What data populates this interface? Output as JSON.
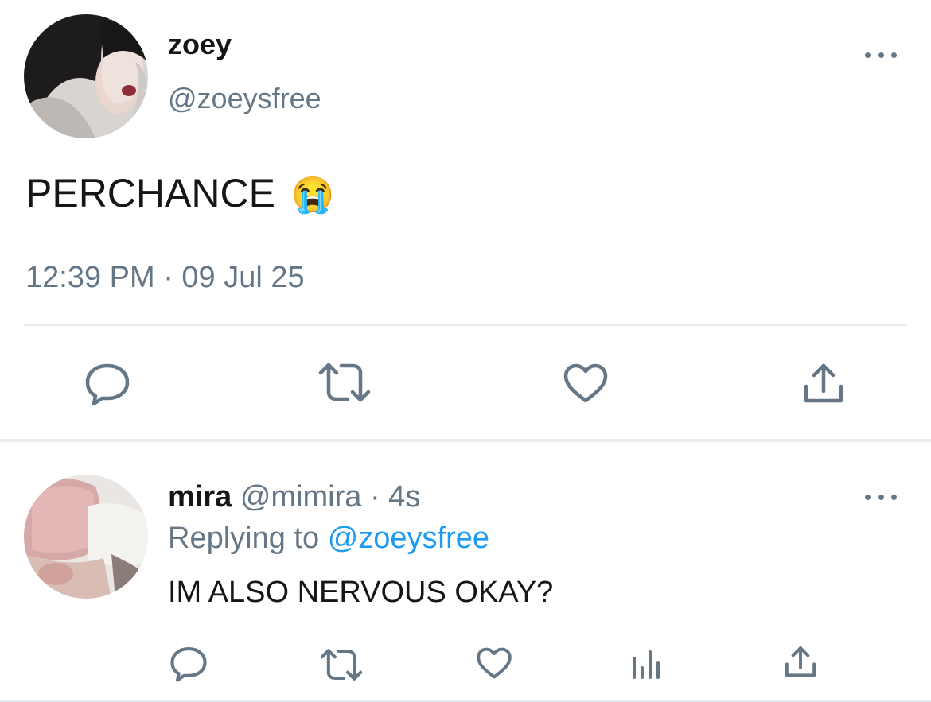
{
  "tweet": {
    "author": {
      "name": "zoey",
      "handle": "@zoeysfree",
      "avatar_icon": "avatar-photo-icon"
    },
    "text": "PERCHANCE",
    "emoji": "😭",
    "timestamp": "12:39 PM · 09 Jul 25",
    "actions": [
      "reply-icon",
      "retweet-icon",
      "like-icon",
      "share-icon"
    ]
  },
  "reply": {
    "author": {
      "name": "mira",
      "handle": "@mimira",
      "time": "· 4s",
      "avatar_icon": "avatar-photo-icon"
    },
    "replying_prefix": "Replying to",
    "replying_to": "@zoeysfree",
    "text": "IM ALSO NERVOUS OKAY?",
    "actions": [
      "reply-icon",
      "retweet-icon",
      "like-icon",
      "analytics-icon",
      "share-icon"
    ]
  },
  "colors": {
    "muted": "#657786",
    "link": "#1d9bf0",
    "divider": "#e6ecf0",
    "text": "#14171a"
  }
}
